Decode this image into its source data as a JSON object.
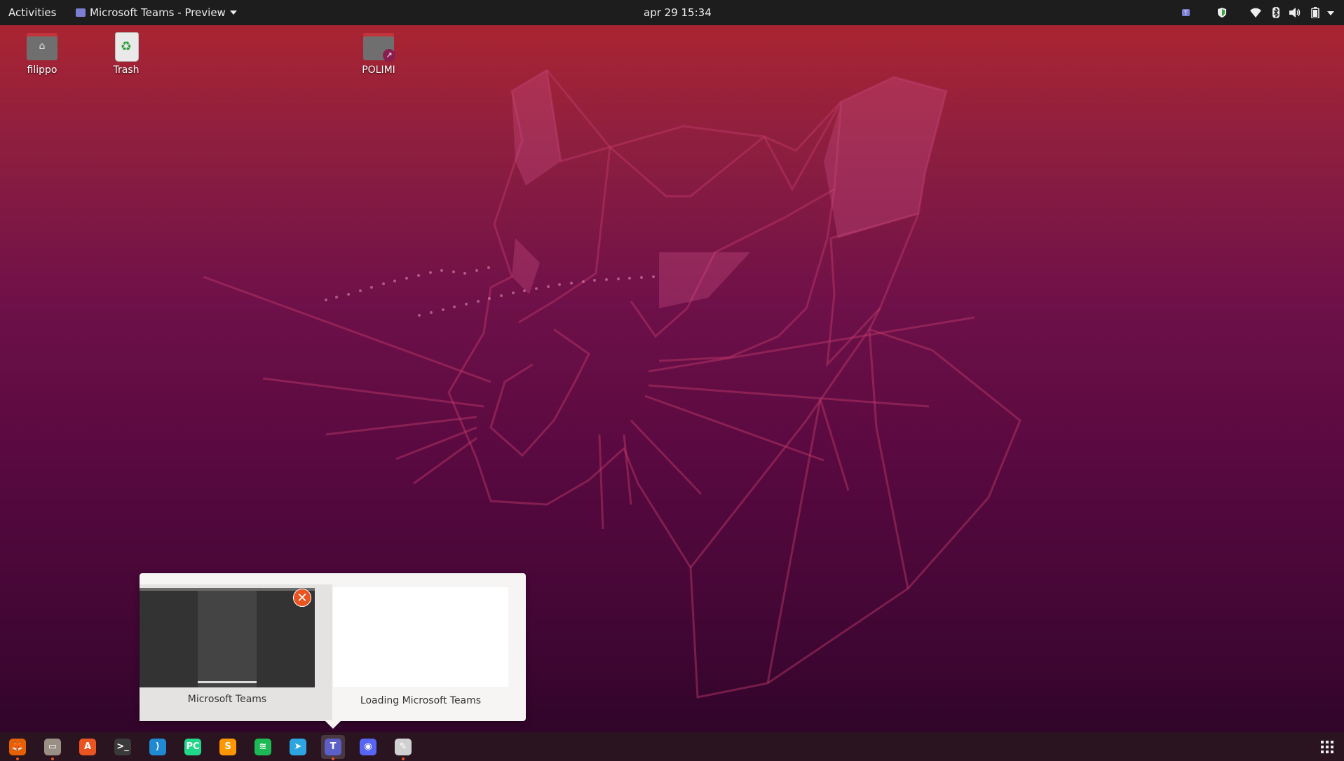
{
  "topbar": {
    "activities": "Activities",
    "app_menu": "Microsoft Teams - Preview",
    "clock": "apr 29  15:34",
    "tray_icons": [
      "teams-tray-icon",
      "shield-icon",
      "wifi-icon",
      "bluetooth-icon",
      "volume-icon",
      "battery-icon",
      "system-menu-caret-icon"
    ]
  },
  "desktop": {
    "icons": [
      {
        "label": "filippo",
        "icon": "home-folder-icon"
      },
      {
        "label": "Trash",
        "icon": "trash-icon"
      },
      {
        "label": "POLIMI",
        "icon": "folder-link-icon"
      }
    ]
  },
  "popup": {
    "previews": [
      {
        "label": "Microsoft Teams"
      },
      {
        "label": "Loading Microsoft Teams"
      }
    ],
    "close_glyph": "✕"
  },
  "dock": {
    "items": [
      {
        "name": "firefox",
        "glyph": "🦊",
        "color": "#e66000",
        "running": true
      },
      {
        "name": "files",
        "glyph": "▭",
        "color": "#9a8f85",
        "running": true
      },
      {
        "name": "software",
        "glyph": "A",
        "color": "#e95420",
        "running": false
      },
      {
        "name": "terminal",
        "glyph": ">_",
        "color": "#3a3a3a",
        "running": false
      },
      {
        "name": "vscode",
        "glyph": "⟩",
        "color": "#1f8ad2",
        "running": false
      },
      {
        "name": "pycharm",
        "glyph": "PC",
        "color": "#21d789",
        "running": false
      },
      {
        "name": "sublime-text",
        "glyph": "S",
        "color": "#ff9800",
        "running": false
      },
      {
        "name": "spotify",
        "glyph": "≋",
        "color": "#1db954",
        "running": false
      },
      {
        "name": "telegram",
        "glyph": "➤",
        "color": "#2ca5e0",
        "running": false
      },
      {
        "name": "teams",
        "glyph": "T",
        "color": "#5b5fc7",
        "running": true,
        "active": true
      },
      {
        "name": "discord",
        "glyph": "◉",
        "color": "#5865f2",
        "running": false
      },
      {
        "name": "image-viewer",
        "glyph": "✎",
        "color": "#d0d0d0",
        "running": true
      }
    ]
  }
}
